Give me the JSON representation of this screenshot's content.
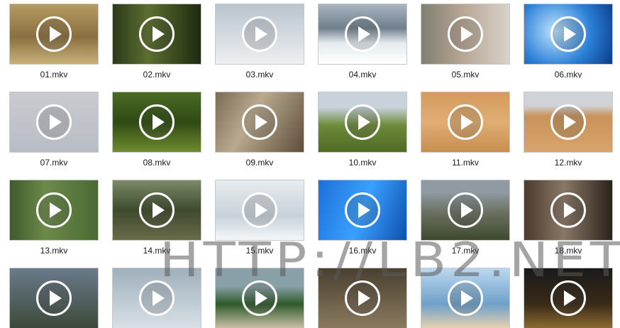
{
  "files": [
    {
      "name": "01.mkv",
      "scene": "savanna"
    },
    {
      "name": "02.mkv",
      "scene": "forest"
    },
    {
      "name": "03.mkv",
      "scene": "peaks"
    },
    {
      "name": "04.mkv",
      "scene": "glacier"
    },
    {
      "name": "05.mkv",
      "scene": "face"
    },
    {
      "name": "06.mkv",
      "scene": "ice"
    },
    {
      "name": "07.mkv",
      "scene": "snowman"
    },
    {
      "name": "08.mkv",
      "scene": "jungle"
    },
    {
      "name": "09.mkv",
      "scene": "cliff"
    },
    {
      "name": "10.mkv",
      "scene": "savtree"
    },
    {
      "name": "11.mkv",
      "scene": "dunes"
    },
    {
      "name": "12.mkv",
      "scene": "desert2"
    },
    {
      "name": "13.mkv",
      "scene": "man"
    },
    {
      "name": "14.mkv",
      "scene": "woods"
    },
    {
      "name": "15.mkv",
      "scene": "snowhole"
    },
    {
      "name": "16.mkv",
      "scene": "bluewater"
    },
    {
      "name": "17.mkv",
      "scene": "redjacket"
    },
    {
      "name": "18.mkv",
      "scene": "closeup"
    },
    {
      "name": "",
      "scene": "r4a"
    },
    {
      "name": "",
      "scene": "r4b"
    },
    {
      "name": "",
      "scene": "r4c"
    },
    {
      "name": "",
      "scene": "r4d"
    },
    {
      "name": "",
      "scene": "r4e"
    },
    {
      "name": "",
      "scene": "r4f"
    }
  ],
  "watermark": "HTTP://LB2.NET",
  "play_icon": "play-icon"
}
